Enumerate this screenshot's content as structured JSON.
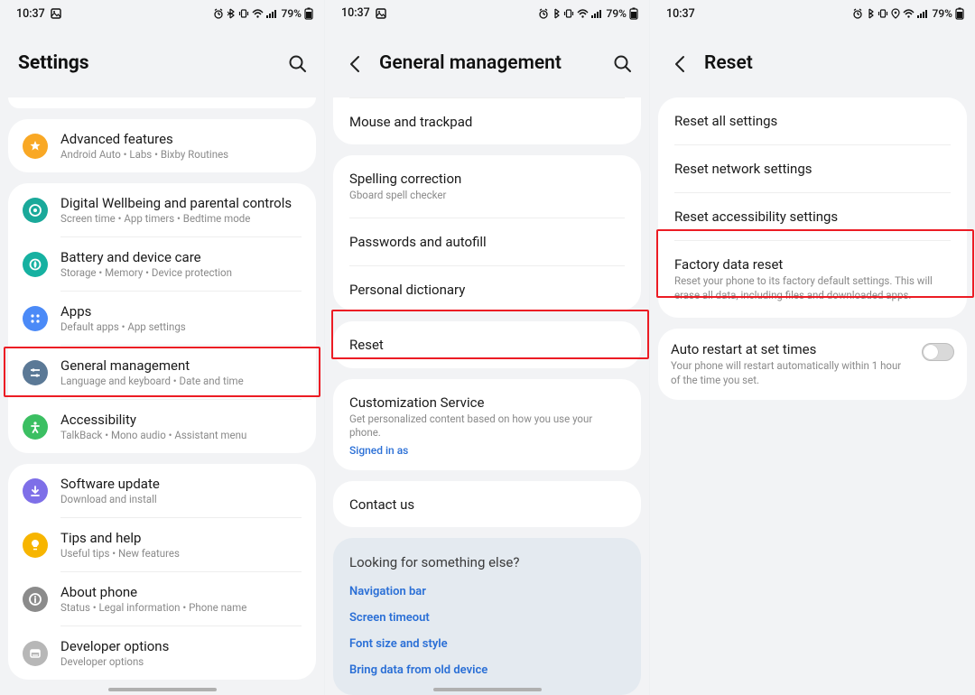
{
  "status": {
    "time": "10:37",
    "battery": "79%"
  },
  "screen1": {
    "title": "Settings",
    "items": [
      {
        "title": "Advanced features",
        "sub": "Android Auto  •  Labs  •  Bixby Routines"
      },
      {
        "title": "Digital Wellbeing and parental controls",
        "sub": "Screen time  •  App timers  •  Bedtime mode"
      },
      {
        "title": "Battery and device care",
        "sub": "Storage  •  Memory  •  Device protection"
      },
      {
        "title": "Apps",
        "sub": "Default apps  •  App settings"
      },
      {
        "title": "General management",
        "sub": "Language and keyboard  •  Date and time"
      },
      {
        "title": "Accessibility",
        "sub": "TalkBack  •  Mono audio  •  Assistant menu"
      },
      {
        "title": "Software update",
        "sub": "Download and install"
      },
      {
        "title": "Tips and help",
        "sub": "Useful tips  •  New features"
      },
      {
        "title": "About phone",
        "sub": "Status  •  Legal information  •  Phone name"
      },
      {
        "title": "Developer options",
        "sub": "Developer options"
      }
    ]
  },
  "screen2": {
    "title": "General management",
    "items": [
      {
        "title": "Mouse and trackpad"
      },
      {
        "title": "Spelling correction",
        "sub": "Gboard spell checker"
      },
      {
        "title": "Passwords and autofill"
      },
      {
        "title": "Personal dictionary"
      },
      {
        "title": "Reset"
      },
      {
        "title": "Customization Service",
        "sub": "Get personalized content based on how you use your phone.",
        "link": "Signed in as"
      },
      {
        "title": "Contact us"
      }
    ],
    "lfse": {
      "heading": "Looking for something else?",
      "links": [
        "Navigation bar",
        "Screen timeout",
        "Font size and style",
        "Bring data from old device"
      ]
    }
  },
  "screen3": {
    "title": "Reset",
    "items": [
      {
        "title": "Reset all settings"
      },
      {
        "title": "Reset network settings"
      },
      {
        "title": "Reset accessibility settings"
      },
      {
        "title": "Factory data reset",
        "sub": "Reset your phone to its factory default settings. This will erase all data, including files and downloaded apps."
      }
    ],
    "toggle": {
      "title": "Auto restart at set times",
      "sub": "Your phone will restart automatically within 1 hour of the time you set."
    }
  }
}
